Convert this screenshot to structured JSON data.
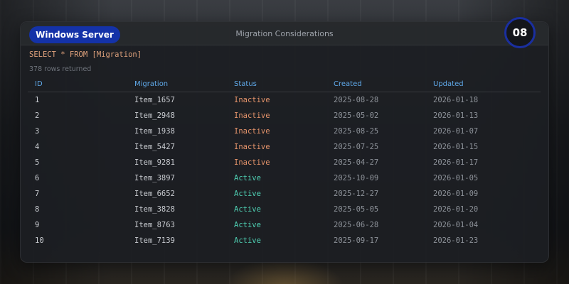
{
  "panel": {
    "brand": "Windows Server",
    "title": "Migration Considerations",
    "badge": "08"
  },
  "query": "SELECT * FROM [Migration]",
  "rows_info": "378 rows returned",
  "table": {
    "columns": [
      "ID",
      "Migration",
      "Status",
      "Created",
      "Updated"
    ],
    "rows": [
      [
        "1",
        "Item_1657",
        "Inactive",
        "2025-08-28",
        "2026-01-18"
      ],
      [
        "2",
        "Item_2948",
        "Inactive",
        "2025-05-02",
        "2026-01-13"
      ],
      [
        "3",
        "Item_1938",
        "Inactive",
        "2025-08-25",
        "2026-01-07"
      ],
      [
        "4",
        "Item_5427",
        "Inactive",
        "2025-07-25",
        "2026-01-15"
      ],
      [
        "5",
        "Item_9281",
        "Inactive",
        "2025-04-27",
        "2026-01-17"
      ],
      [
        "6",
        "Item_3897",
        "Active",
        "2025-10-09",
        "2026-01-05"
      ],
      [
        "7",
        "Item_6652",
        "Active",
        "2025-12-27",
        "2026-01-09"
      ],
      [
        "8",
        "Item_3828",
        "Active",
        "2025-05-05",
        "2026-01-20"
      ],
      [
        "9",
        "Item_8763",
        "Active",
        "2025-06-28",
        "2026-01-04"
      ],
      [
        "10",
        "Item_7139",
        "Active",
        "2025-09-17",
        "2026-01-23"
      ]
    ]
  },
  "colors": {
    "brand": "#1432a8",
    "header_text": "#5fa8e8",
    "inactive": "#e6946b",
    "active": "#4fd1b4",
    "query": "#e0a27c"
  }
}
